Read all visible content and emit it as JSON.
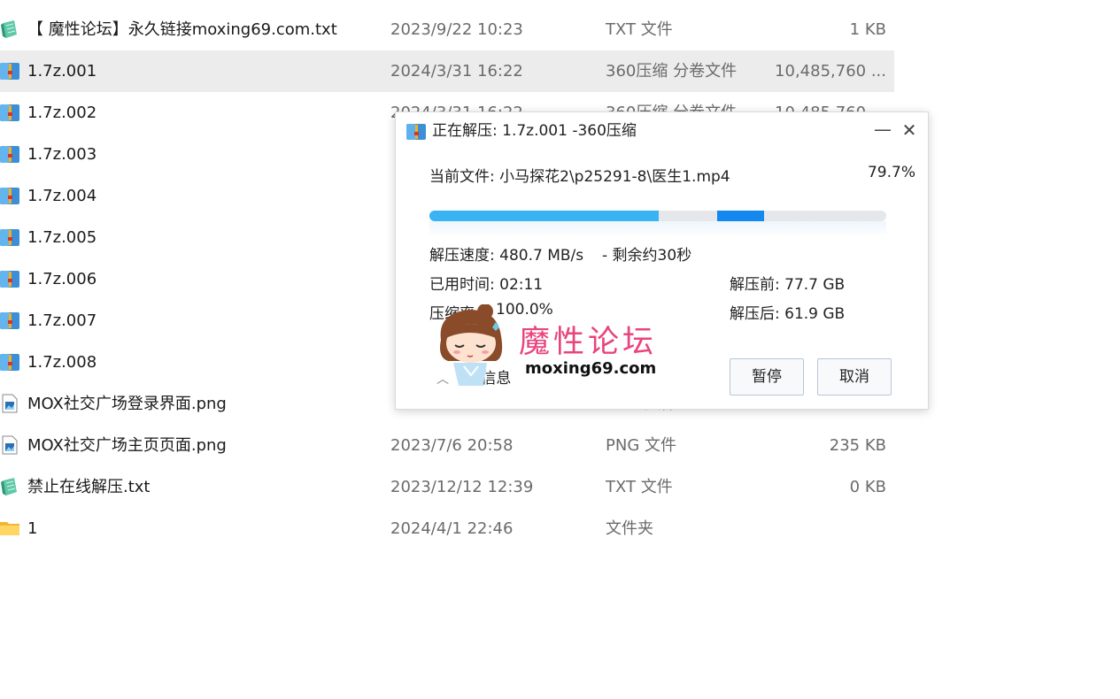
{
  "files": [
    {
      "name": "【 魔性论坛】永久链接moxing69.com.txt",
      "date": "2023/9/22 10:23",
      "type": "TXT 文件",
      "size": "1 KB",
      "icon": "txt-notepad-icon",
      "selected": false
    },
    {
      "name": "1.7z.001",
      "date": "2024/3/31 16:22",
      "type": "360压缩 分卷文件",
      "size": "10,485,760 ...",
      "icon": "archive-icon",
      "selected": true
    },
    {
      "name": "1.7z.002",
      "date": "2024/3/31 16:22",
      "type": "360压缩 分卷文件",
      "size": "10,485,760 ...",
      "icon": "archive-icon",
      "selected": false
    },
    {
      "name": "1.7z.003",
      "date": "",
      "type": "",
      "size": "",
      "icon": "archive-icon",
      "selected": false
    },
    {
      "name": "1.7z.004",
      "date": "",
      "type": "",
      "size": "",
      "icon": "archive-icon",
      "selected": false
    },
    {
      "name": "1.7z.005",
      "date": "",
      "type": "",
      "size": "",
      "icon": "archive-icon",
      "selected": false
    },
    {
      "name": "1.7z.006",
      "date": "",
      "type": "",
      "size": "",
      "icon": "archive-icon",
      "selected": false
    },
    {
      "name": "1.7z.007",
      "date": "",
      "type": "",
      "size": "",
      "icon": "archive-icon",
      "selected": false
    },
    {
      "name": "1.7z.008",
      "date": "",
      "type": "",
      "size": "",
      "icon": "archive-icon",
      "selected": false
    },
    {
      "name": "MOX社交广场登录界面.png",
      "date": "",
      "type": "PNG 文件",
      "size": "",
      "icon": "png-image-icon",
      "selected": false
    },
    {
      "name": "MOX社交广场主页页面.png",
      "date": "2023/7/6 20:58",
      "type": "PNG 文件",
      "size": "235 KB",
      "icon": "png-image-icon",
      "selected": false
    },
    {
      "name": "禁止在线解压.txt",
      "date": "2023/12/12 12:39",
      "type": "TXT 文件",
      "size": "0 KB",
      "icon": "txt-notepad-icon",
      "selected": false
    },
    {
      "name": "1",
      "date": "2024/4/1 22:46",
      "type": "文件夹",
      "size": "",
      "icon": "folder-icon",
      "selected": false
    }
  ],
  "dialog": {
    "title": "正在解压: 1.7z.001 -360压缩",
    "minimize_glyph": "—",
    "close_glyph": "✕",
    "current_file": "当前文件: 小马探花2\\p25291-8\\医生1.mp4",
    "percent_text": "79.7%",
    "progress": {
      "overall_fraction": 0.797,
      "file_fraction_start": 0.63
    },
    "speed": "解压速度: 480.7 MB/s",
    "remaining": "- 剩余约30秒",
    "elapsed": "已用时间: 02:11",
    "before": "解压前: 77.7 GB",
    "ratio_label": "压缩率",
    "ratio_value": "100.0%",
    "after": "解压后: 61.9 GB",
    "more_label": "略信息",
    "pause_label": "暂停",
    "cancel_label": "取消"
  },
  "watermark": {
    "title": "魔性论坛",
    "url": "moxing69.com"
  },
  "colors": {
    "selected_row": "#ececec",
    "progress_light": "#3ab3f2",
    "progress_dark": "#1488ef",
    "watermark_pink": "#e8447d"
  }
}
